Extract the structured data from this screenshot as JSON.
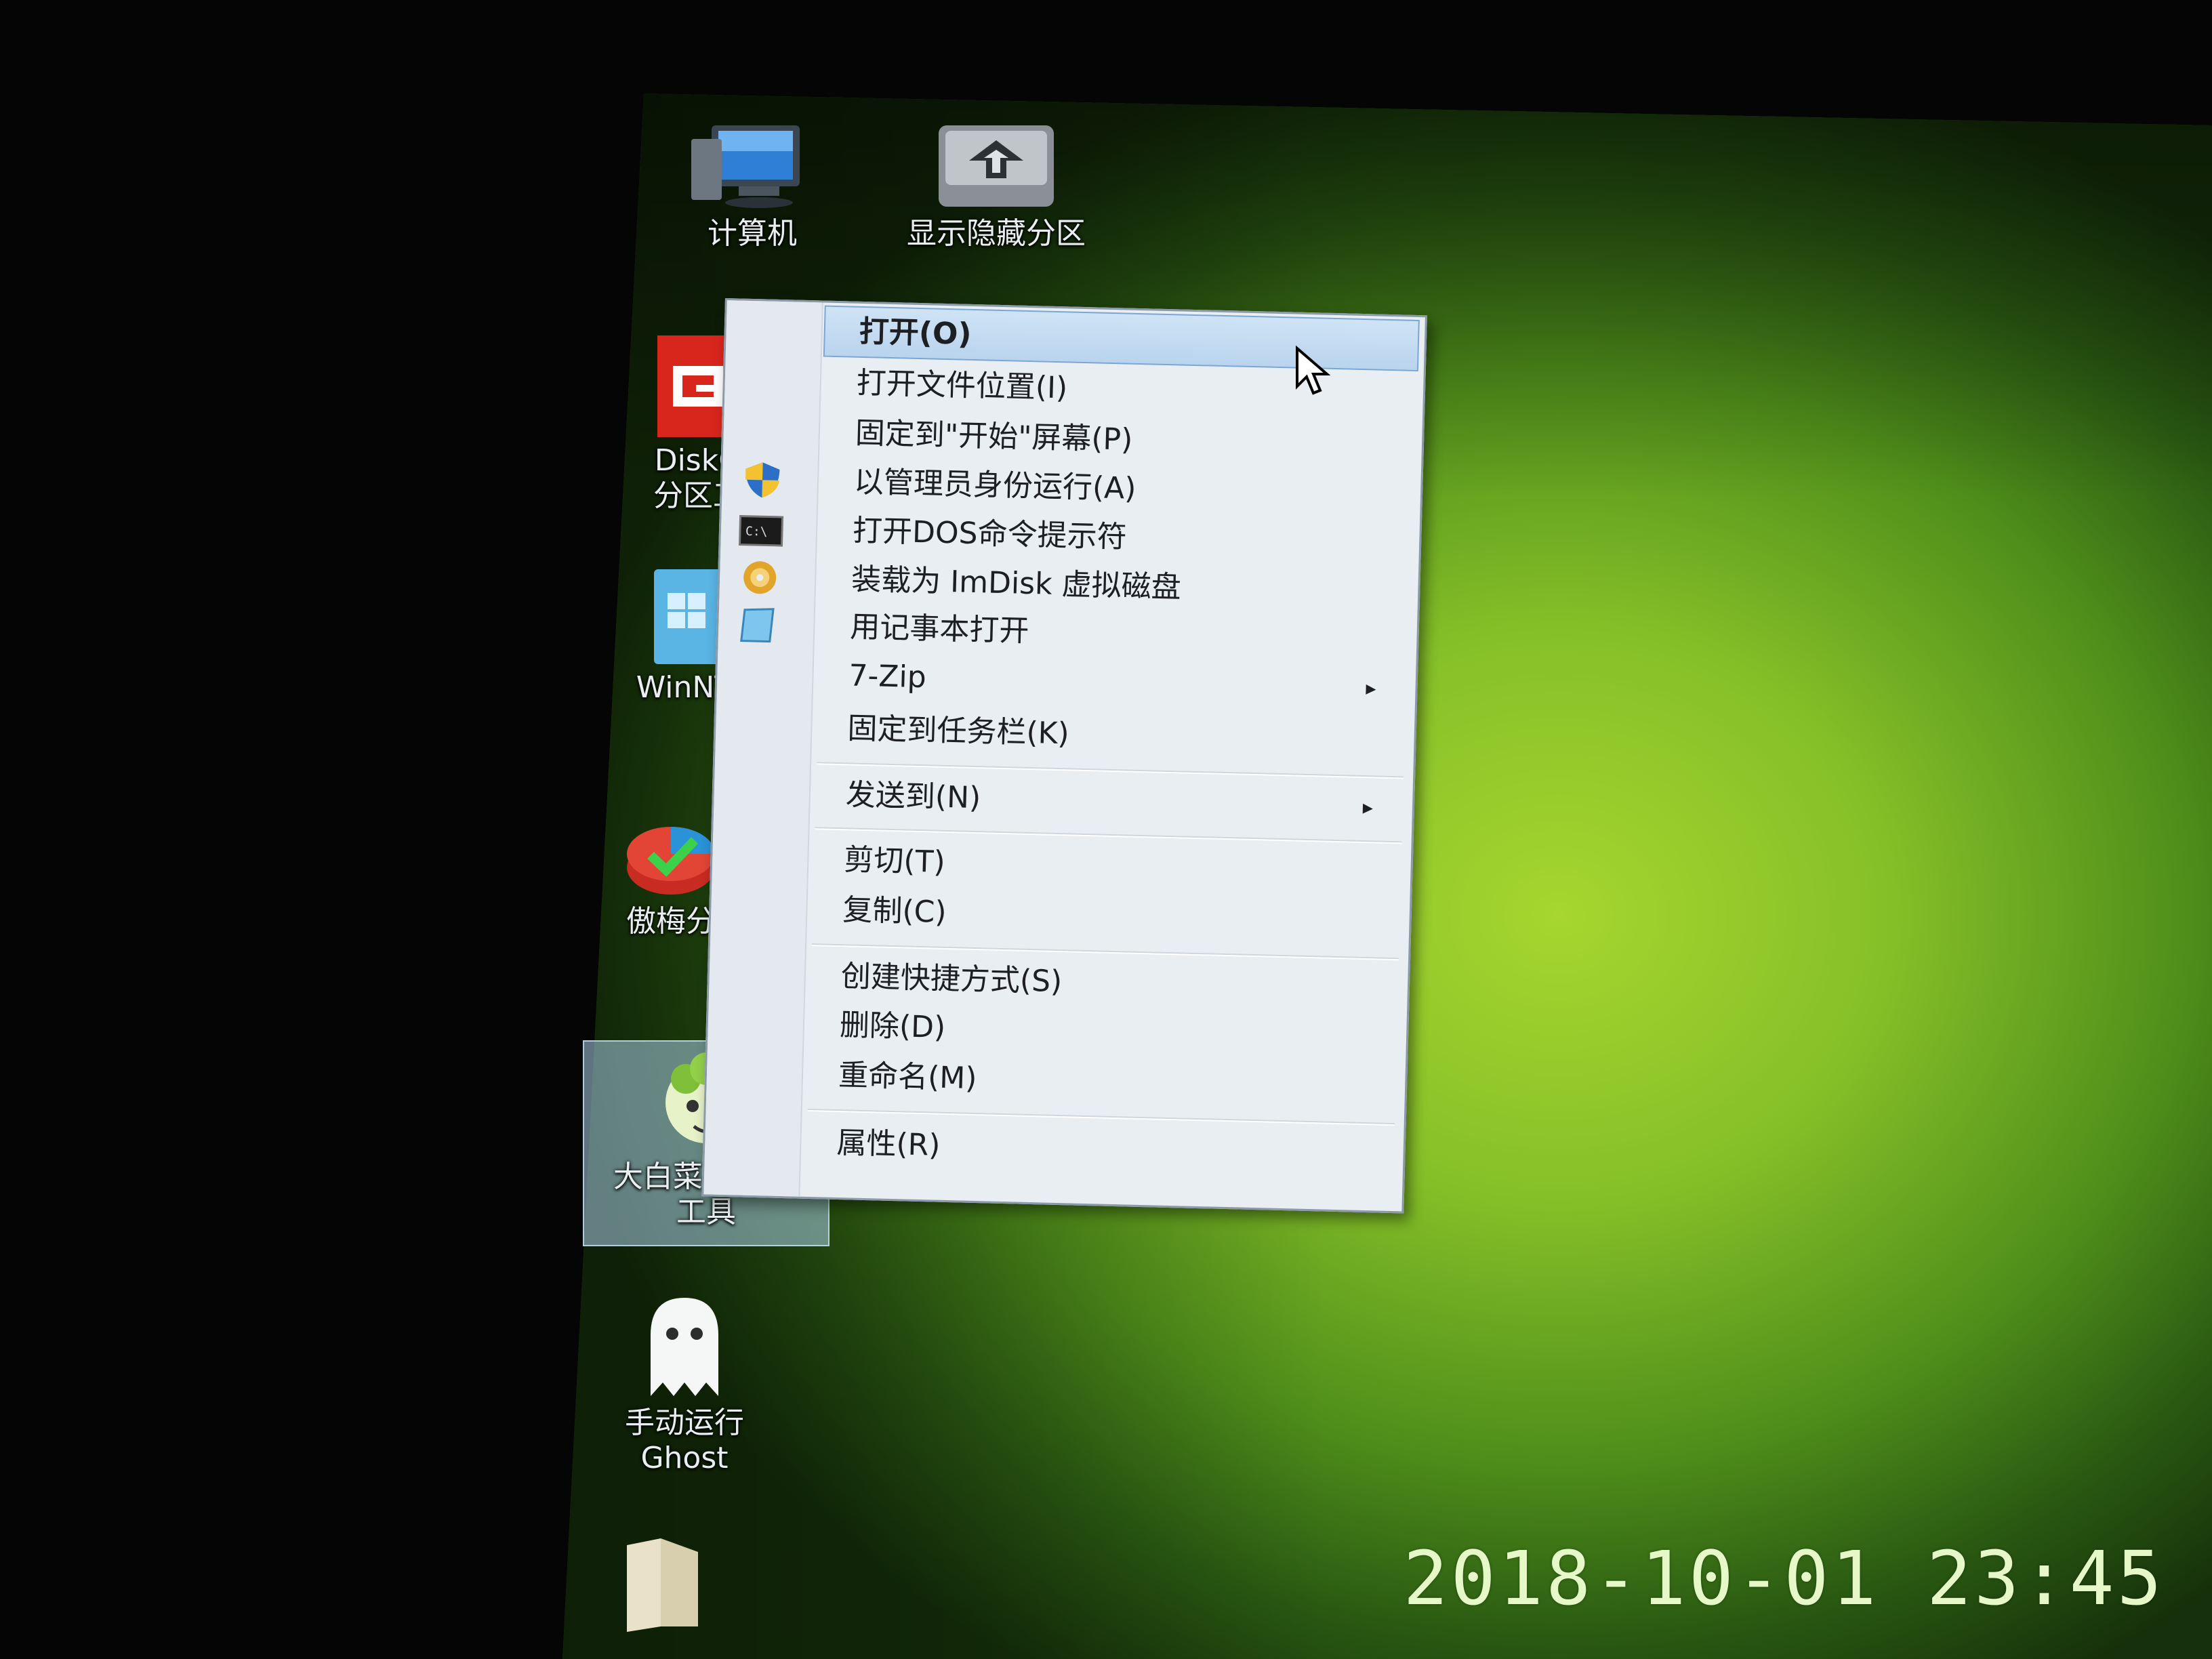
{
  "desktop": {
    "icons": [
      {
        "id": "computer",
        "label": "计算机"
      },
      {
        "id": "show-hidden-partition",
        "label": "显示隐藏分区"
      },
      {
        "id": "diskgenius",
        "label_line1": "DiskG",
        "label_line2": "分区工"
      },
      {
        "id": "winnt",
        "label": "WinNT"
      },
      {
        "id": "partition-assistant",
        "label": "傲梅分"
      },
      {
        "id": "dabaicai-pe",
        "label_line1": "大白菜PE装机",
        "label_line2": "工具"
      },
      {
        "id": "ghost",
        "label_line1": "手动运行",
        "label_line2": "Ghost"
      },
      {
        "id": "folder",
        "label": ""
      }
    ]
  },
  "context_menu": {
    "items": [
      {
        "label": "打开(O)",
        "icon": ""
      },
      {
        "label": "打开文件位置(I)",
        "icon": ""
      },
      {
        "label": "固定到\"开始\"屏幕(P)",
        "icon": ""
      },
      {
        "label": "以管理员身份运行(A)",
        "icon": "uac-shield-icon"
      },
      {
        "label": "打开DOS命令提示符",
        "icon": "cmd-icon"
      },
      {
        "label": "装载为 ImDisk 虚拟磁盘",
        "icon": "disc-icon"
      },
      {
        "label": "用记事本打开",
        "icon": "notepad-icon"
      },
      {
        "label": "7-Zip",
        "icon": "",
        "submenu": true
      },
      {
        "label": "固定到任务栏(K)",
        "icon": ""
      },
      {
        "label": "发送到(N)",
        "icon": "",
        "submenu": true
      },
      {
        "label": "剪切(T)",
        "icon": ""
      },
      {
        "label": "复制(C)",
        "icon": ""
      },
      {
        "label": "创建快捷方式(S)",
        "icon": ""
      },
      {
        "label": "删除(D)",
        "icon": ""
      },
      {
        "label": "重命名(M)",
        "icon": ""
      },
      {
        "label": "属性(R)",
        "icon": ""
      }
    ],
    "submenu_arrow": "▸"
  },
  "photo": {
    "timestamp": "2018-10-01  23:45"
  }
}
